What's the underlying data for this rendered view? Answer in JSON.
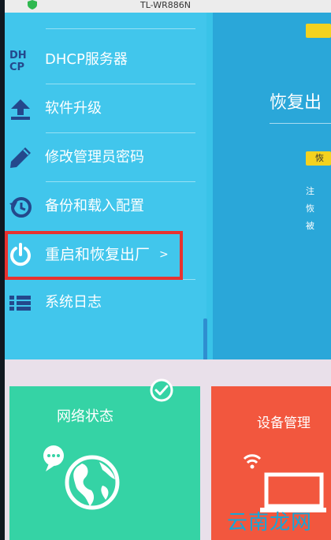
{
  "window": {
    "title": "TL-WR886N"
  },
  "menu": {
    "items": [
      {
        "label": "DHCP服务器",
        "icon": "dhcp-icon"
      },
      {
        "label": "软件升级",
        "icon": "upload-icon"
      },
      {
        "label": "修改管理员密码",
        "icon": "pencil-icon"
      },
      {
        "label": "备份和载入配置",
        "icon": "history-icon"
      },
      {
        "label": "重启和恢复出厂",
        "icon": "power-icon",
        "chevron": ">"
      },
      {
        "label": "系统日志",
        "icon": "list-icon"
      }
    ],
    "icon_dhcp_text": "DH\nCP"
  },
  "panel": {
    "heading": "恢复出",
    "tag_text": "恢",
    "lines": [
      "注",
      "恢",
      "被"
    ]
  },
  "cards": {
    "network_status": "网络状态",
    "device_manage": "设备管理"
  },
  "watermark": "云南龙网",
  "colors": {
    "menu_bg": "#41c6ec",
    "highlight": "#e8322f",
    "green_card": "#35d3a5",
    "red_card": "#f2573e",
    "tag_yellow": "#f4d21f"
  }
}
